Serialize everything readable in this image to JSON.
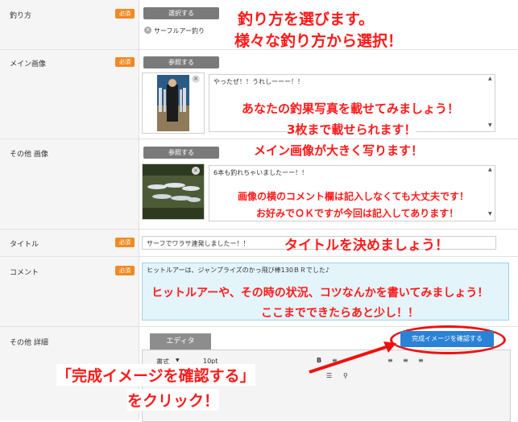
{
  "form": {
    "method": {
      "label": "釣り方",
      "required": "必須",
      "select_button": "選択する",
      "selected_item": "サーフルアー釣り"
    },
    "main_image": {
      "label": "メイン画像",
      "required": "必須",
      "browse_button": "参照する",
      "comment": "やったぜ！！うれしーーー！！"
    },
    "other_images": {
      "label": "その他 画像",
      "browse_button": "参照する",
      "comment": "6本も釣れちゃいましたーー！！"
    },
    "title": {
      "label": "タイトル",
      "required": "必須",
      "value": "サーフでワラサ連発しましたー！！"
    },
    "comment": {
      "label": "コメント",
      "required": "必須",
      "value": "ヒットルアーは、ジャンプライズのかっ飛び棒130ＢＲでした♪"
    },
    "details": {
      "label": "その他 詳細",
      "editor_tab": "エディタ",
      "format_label": "書式",
      "font_size": "10pt"
    }
  },
  "confirm_button": "完成イメージを確認する",
  "annotations": {
    "a1_line1": "釣り方を選びます。",
    "a1_line2": "様々な釣り方から選択！",
    "a2_line1": "あなたの釣果写真を載せてみましょう！",
    "a2_line2": "3枚まで載せられます！",
    "a2_line3": "メイン画像が大きく写ります！",
    "a3_line1": "画像の横のコメント欄は記入しなくても大丈夫です！",
    "a3_line2": "お好みでＯＫですが今回は記入してあります！",
    "a4": "タイトルを決めましょう！",
    "a5_line1": "ヒットルアーや、その時の状況、コツなんかを書いてみましょう！",
    "a5_line2": "ここまでできたらあと少し！！",
    "a6_line1": "「完成イメージを確認する」",
    "a6_line2": "をクリック！"
  },
  "colors": {
    "required_badge": "#f08a24",
    "annotation": "#ff1a1a",
    "confirm_button": "#2a82d6",
    "comment_highlight": "#e4f4fb"
  }
}
